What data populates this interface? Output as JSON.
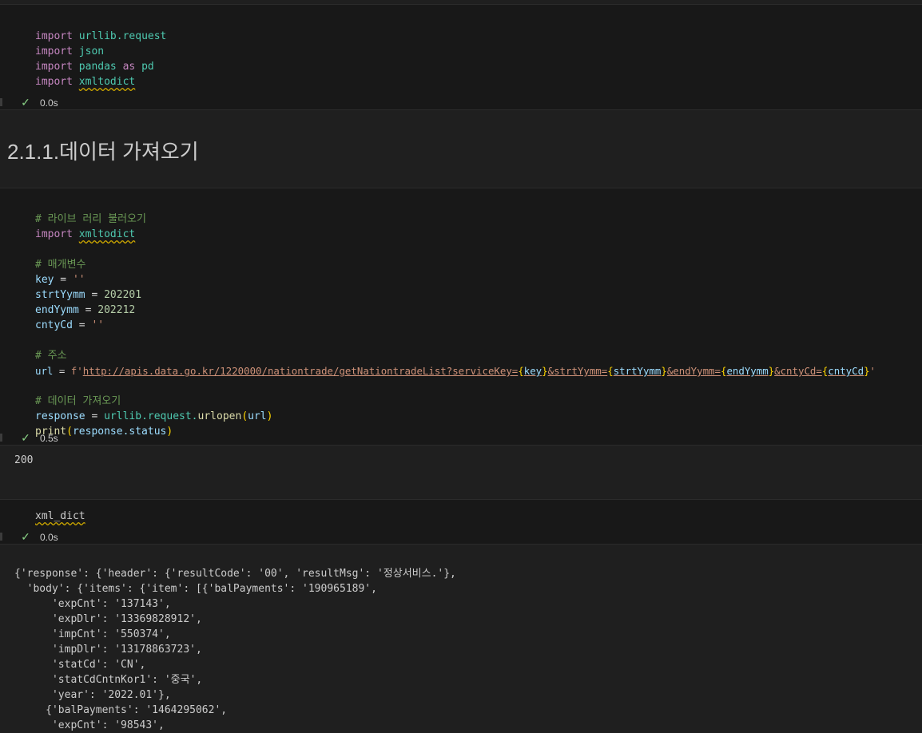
{
  "cell1": {
    "lines": [
      [
        "import",
        "urllib.request"
      ],
      [
        "import",
        "json"
      ],
      [
        "import",
        "pandas",
        "as",
        "pd"
      ],
      [
        "import",
        "xmltodict"
      ]
    ],
    "status": "0.0s"
  },
  "heading": "2.1.1.데이터 가져오기",
  "cell2": {
    "comment1": "# 라이브 러리 불러오기",
    "import_kw": "import",
    "import_mod": "xmltodict",
    "comment2": "# 매개변수",
    "key_var": "key",
    "key_val": "''",
    "strt_var": "strtYymm",
    "strt_val": "202201",
    "end_var": "endYymm",
    "end_val": "202212",
    "cnty_var": "cntyCd",
    "cnty_val": "''",
    "comment3": "# 주소",
    "url_var": "url",
    "url_prefix": "f'",
    "url_part1": "http://apis.data.go.kr/1220000/nationtrade/getNationtradeList?serviceKey=",
    "url_k1": "key",
    "url_part2": "&strtYymm=",
    "url_k2": "strtYymm",
    "url_part3": "&endYymm=",
    "url_k3": "endYymm",
    "url_part4": "&cntyCd=",
    "url_k4": "cntyCd",
    "url_end": "'",
    "comment4": "# 데이터 가져오기",
    "resp_var": "response",
    "resp_mod": "urllib.request.",
    "resp_fn": "urlopen",
    "resp_arg": "url",
    "print_fn": "print",
    "print_arg": "response.status",
    "status": "0.5s",
    "output": "200"
  },
  "cell3": {
    "code": "xml_dict",
    "status": "0.0s",
    "output_lines": [
      "{'response': {'header': {'resultCode': '00', 'resultMsg': '정상서비스.'},",
      "  'body': {'items': {'item': [{'balPayments': '190965189',",
      "      'expCnt': '137143',",
      "      'expDlr': '13369828912',",
      "      'impCnt': '550374',",
      "      'impDlr': '13178863723',",
      "      'statCd': 'CN',",
      "      'statCdCntnKor1': '중국',",
      "      'year': '2022.01'},",
      "     {'balPayments': '1464295062',",
      "      'expCnt': '98543',"
    ]
  }
}
